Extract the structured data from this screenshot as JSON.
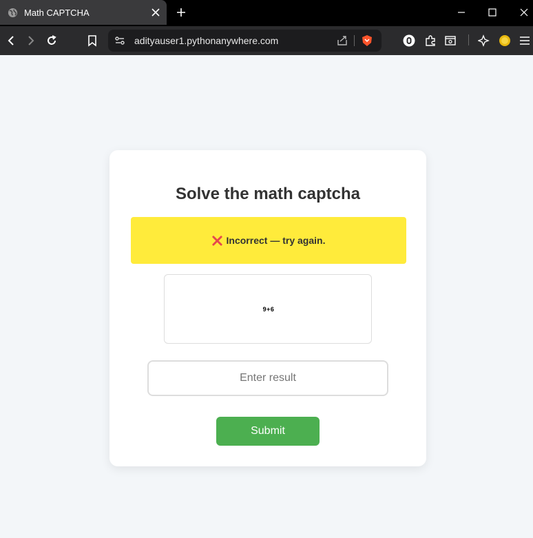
{
  "browser": {
    "tab_title": "Math CAPTCHA",
    "url": "adityauser1.pythonanywhere.com"
  },
  "page": {
    "title": "Solve the math captcha",
    "alert": {
      "icon": "cross-mark-icon",
      "message": "Incorrect — try again.",
      "color": "#ffeb3b"
    },
    "captcha": {
      "expression": "9+6"
    },
    "result_input": {
      "value": "",
      "placeholder": "Enter result"
    },
    "submit_label": "Submit",
    "accent_color": "#4caf50"
  }
}
